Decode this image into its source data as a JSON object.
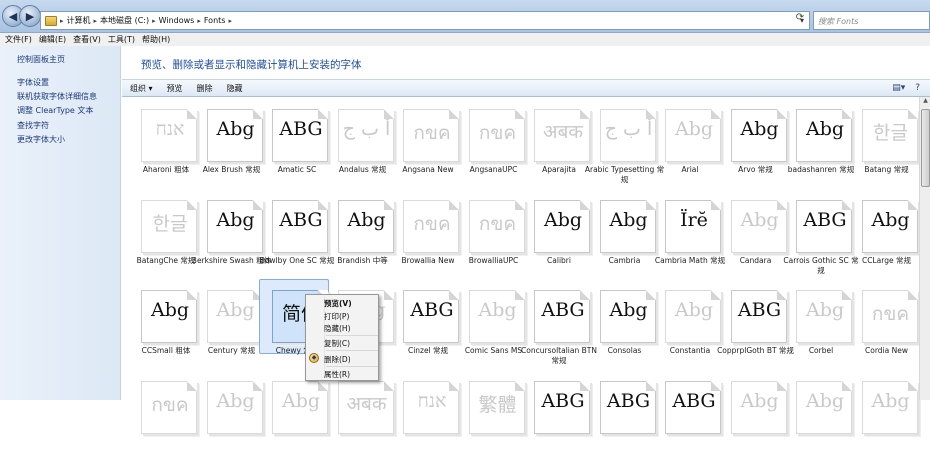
{
  "address": {
    "crumbs": [
      "计算机",
      "本地磁盘 (C:)",
      "Windows",
      "Fonts"
    ],
    "search_placeholder": "搜索 Fonts"
  },
  "menubar": [
    "文件(F)",
    "编辑(E)",
    "查看(V)",
    "工具(T)",
    "帮助(H)"
  ],
  "sidebar": {
    "home": "控制面板主页",
    "links": [
      "字体设置",
      "联机获取字体详细信息",
      "调整 ClearType 文本",
      "查找字符",
      "更改字体大小"
    ]
  },
  "main": {
    "title": "预览、删除或者显示和隐藏计算机上安装的字体"
  },
  "toolbar": [
    "组织 ▾",
    "预览",
    "删除",
    "隐藏"
  ],
  "fonts": [
    {
      "glyph": "אנח",
      "label": "Aharoni 粗体",
      "faded": true
    },
    {
      "glyph": "Abg",
      "label": "Alex Brush 常规",
      "faded": false
    },
    {
      "glyph": "ABG",
      "label": "Amatic SC",
      "faded": false
    },
    {
      "glyph": "أ ب ج",
      "label": "Andalus 常规",
      "faded": true
    },
    {
      "glyph": "กขค",
      "label": "Angsana New",
      "faded": true
    },
    {
      "glyph": "กขค",
      "label": "AngsanaUPC",
      "faded": true
    },
    {
      "glyph": "अबक",
      "label": "Aparajita",
      "faded": true
    },
    {
      "glyph": "أ ب ج",
      "label": "Arabic Typesetting 常规",
      "faded": true
    },
    {
      "glyph": "Abg",
      "label": "Arial",
      "faded": true
    },
    {
      "glyph": "Abg",
      "label": "Arvo 常规",
      "faded": false
    },
    {
      "glyph": "Abg",
      "label": "badashanren 常规",
      "faded": false
    },
    {
      "glyph": "한글",
      "label": "Batang 常规",
      "faded": true
    },
    {
      "glyph": "한글",
      "label": "BatangChe 常规",
      "faded": true
    },
    {
      "glyph": "Abg",
      "label": "Berkshire Swash 粗体",
      "faded": false
    },
    {
      "glyph": "ABG",
      "label": "Bowlby One SC 常规",
      "faded": false
    },
    {
      "glyph": "Abg",
      "label": "Brandish 中等",
      "faded": false
    },
    {
      "glyph": "กขค",
      "label": "Browallia New",
      "faded": true
    },
    {
      "glyph": "กขค",
      "label": "BrowalliaUPC",
      "faded": true
    },
    {
      "glyph": "Abg",
      "label": "Calibri",
      "faded": false
    },
    {
      "glyph": "Abg",
      "label": "Cambria",
      "faded": false
    },
    {
      "glyph": "Ïrĕ",
      "label": "Cambria Math 常规",
      "faded": false
    },
    {
      "glyph": "Abg",
      "label": "Candara",
      "faded": true
    },
    {
      "glyph": "ABG",
      "label": "Carrois Gothic SC 常规",
      "faded": false
    },
    {
      "glyph": "Abg",
      "label": "CCLarge 常规",
      "faded": false
    },
    {
      "glyph": "Abg",
      "label": "CCSmall 粗体",
      "faded": false
    },
    {
      "glyph": "Abg",
      "label": "Century 常规",
      "faded": true
    },
    {
      "glyph": "简体",
      "label": "Chewy 常规",
      "faded": false,
      "selected": true
    },
    {
      "glyph": "Abg",
      "label": "ic",
      "faded": true
    },
    {
      "glyph": "ABG",
      "label": "Cinzel 常规",
      "faded": false
    },
    {
      "glyph": "Abg",
      "label": "Comic Sans MS",
      "faded": true
    },
    {
      "glyph": "ABG",
      "label": "Concursoltalian BTN 常规",
      "faded": false
    },
    {
      "glyph": "Abg",
      "label": "Consolas",
      "faded": false
    },
    {
      "glyph": "Abg",
      "label": "Constantia",
      "faded": true
    },
    {
      "glyph": "ABG",
      "label": "CopprplGoth BT 常规",
      "faded": false
    },
    {
      "glyph": "Abg",
      "label": "Corbel",
      "faded": true
    },
    {
      "glyph": "กขค",
      "label": "Cordia New",
      "faded": true
    },
    {
      "glyph": "กขค",
      "label": "",
      "faded": true
    },
    {
      "glyph": "Abg",
      "label": "",
      "faded": true
    },
    {
      "glyph": "Abg",
      "label": "",
      "faded": true
    },
    {
      "glyph": "अबक",
      "label": "",
      "faded": true
    },
    {
      "glyph": "אנח",
      "label": "",
      "faded": true
    },
    {
      "glyph": "繁體",
      "label": "",
      "faded": true
    },
    {
      "glyph": "ABG",
      "label": "",
      "faded": false
    },
    {
      "glyph": "ABG",
      "label": "",
      "faded": false
    },
    {
      "glyph": "ABG",
      "label": "",
      "faded": false
    },
    {
      "glyph": "Abg",
      "label": "",
      "faded": true
    },
    {
      "glyph": "Abg",
      "label": "",
      "faded": true
    },
    {
      "glyph": "Abg",
      "label": "",
      "faded": true
    }
  ],
  "context_menu": {
    "items": [
      "预览(V)",
      "打印(P)",
      "隐藏(H)",
      "复制(C)",
      "删除(D)",
      "属性(R)"
    ]
  }
}
